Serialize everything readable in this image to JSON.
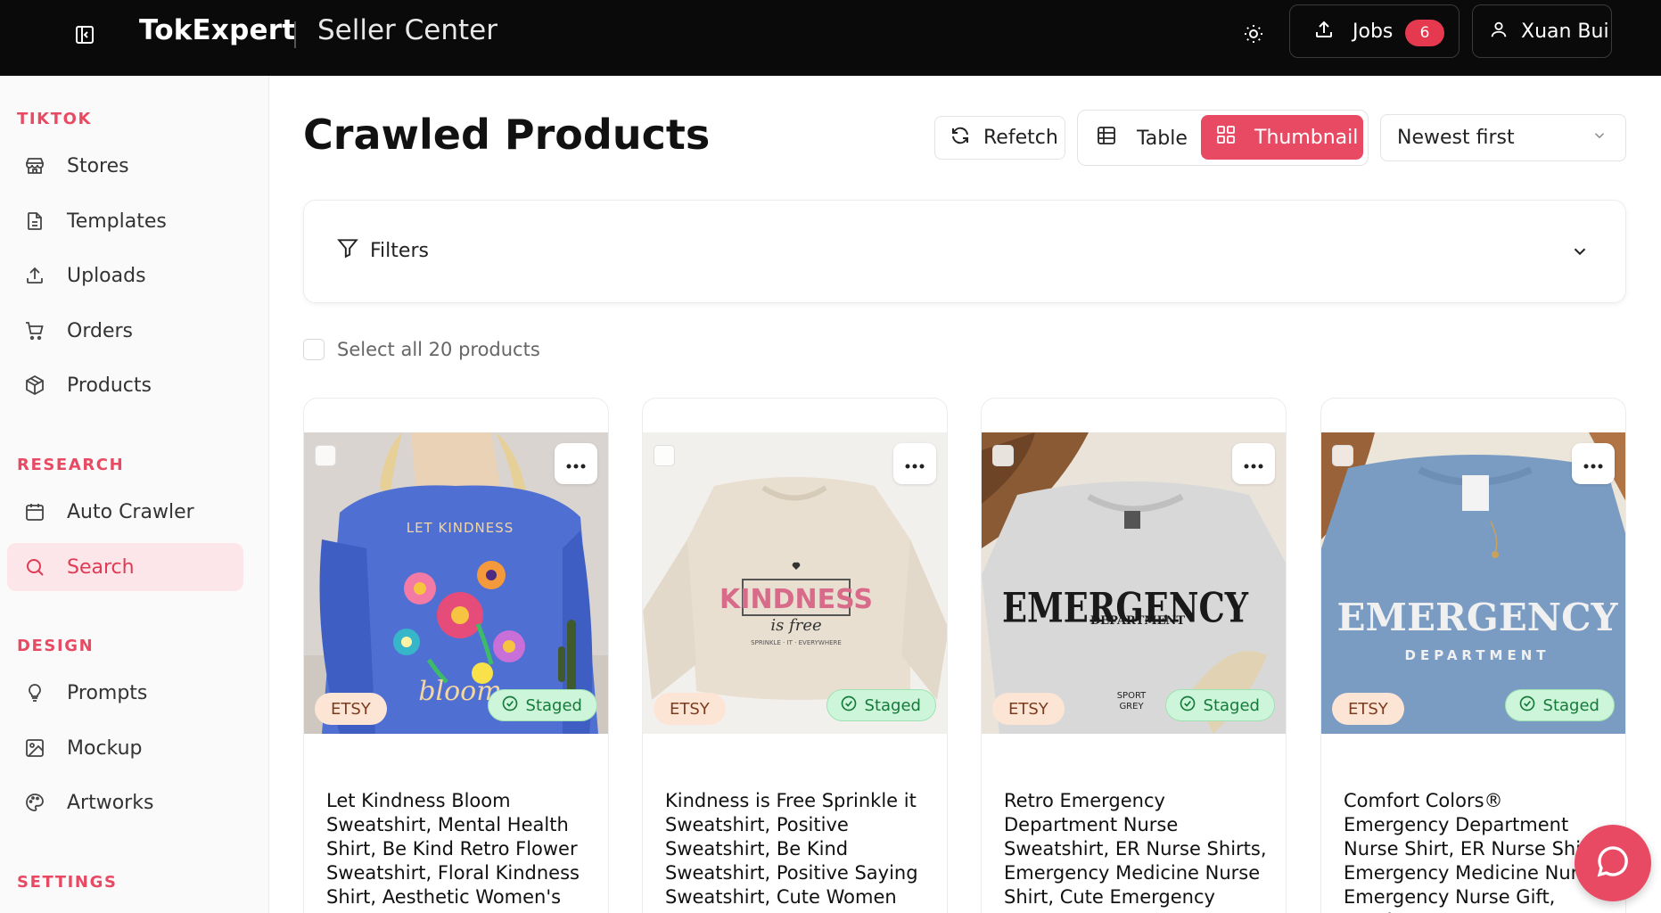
{
  "header": {
    "brand": "TokExpert",
    "subtitle": "Seller Center",
    "jobs_label": "Jobs",
    "jobs_count": "6",
    "user_name": "Xuan Bui"
  },
  "sidebar": {
    "sections": [
      {
        "label": "TIKTOK",
        "items": [
          {
            "label": "Stores",
            "icon": "store-icon"
          },
          {
            "label": "Templates",
            "icon": "file-text-icon"
          },
          {
            "label": "Uploads",
            "icon": "upload-icon"
          },
          {
            "label": "Orders",
            "icon": "cart-icon"
          },
          {
            "label": "Products",
            "icon": "package-icon"
          }
        ]
      },
      {
        "label": "RESEARCH",
        "items": [
          {
            "label": "Auto Crawler",
            "icon": "calendar-icon"
          },
          {
            "label": "Search",
            "icon": "search-icon",
            "active": true
          }
        ]
      },
      {
        "label": "DESIGN",
        "items": [
          {
            "label": "Prompts",
            "icon": "lightbulb-icon"
          },
          {
            "label": "Mockup",
            "icon": "image-icon"
          },
          {
            "label": "Artworks",
            "icon": "palette-icon"
          }
        ]
      },
      {
        "label": "SETTINGS",
        "items": []
      }
    ]
  },
  "main": {
    "title": "Crawled Products",
    "refetch_label": "Refetch",
    "view_table_label": "Table",
    "view_thumbnail_label": "Thumbnail",
    "sort_value": "Newest first",
    "filters_label": "Filters",
    "select_all_label": "Select all 20 products",
    "products": [
      {
        "source": "ETSY",
        "status": "Staged",
        "title": "Let Kindness Bloom Sweatshirt, Mental Health Shirt, Be Kind Retro Flower Sweatshirt, Floral Kindness Shirt, Aesthetic Women's",
        "image_text": [
          "LET KINDNESS",
          "bloom"
        ]
      },
      {
        "source": "ETSY",
        "status": "Staged",
        "title": "Kindness is Free Sprinkle it Sweatshirt, Positive Sweatshirt, Be Kind Sweatshirt, Positive Saying Sweatshirt, Cute Women",
        "image_text": [
          "KINDNESS",
          "is free",
          "SPRINKLE · IT · EVERYWHERE"
        ]
      },
      {
        "source": "ETSY",
        "status": "Staged",
        "title": "Retro Emergency Department Nurse Sweatshirt, ER Nurse Shirts, Emergency Medicine Nurse Shirt, Cute Emergency Nurse",
        "image_text": [
          "EMERGENCY",
          "DEPARTMENT",
          "SPORT GREY"
        ]
      },
      {
        "source": "ETSY",
        "status": "Staged",
        "title": "Comfort Colors® Emergency Department Nurse Shirt, ER Nurse Shirt, Emergency Medicine Nurse, Emergency Nurse Gift, Nursing",
        "image_text": [
          "EMERGENCY",
          "DEPARTMENT"
        ]
      }
    ]
  },
  "colors": {
    "accent": "#e84a63",
    "topbar": "#0a0a0a",
    "staged_bg": "#cdf5d9",
    "etsy_bg": "#fde5d6"
  }
}
